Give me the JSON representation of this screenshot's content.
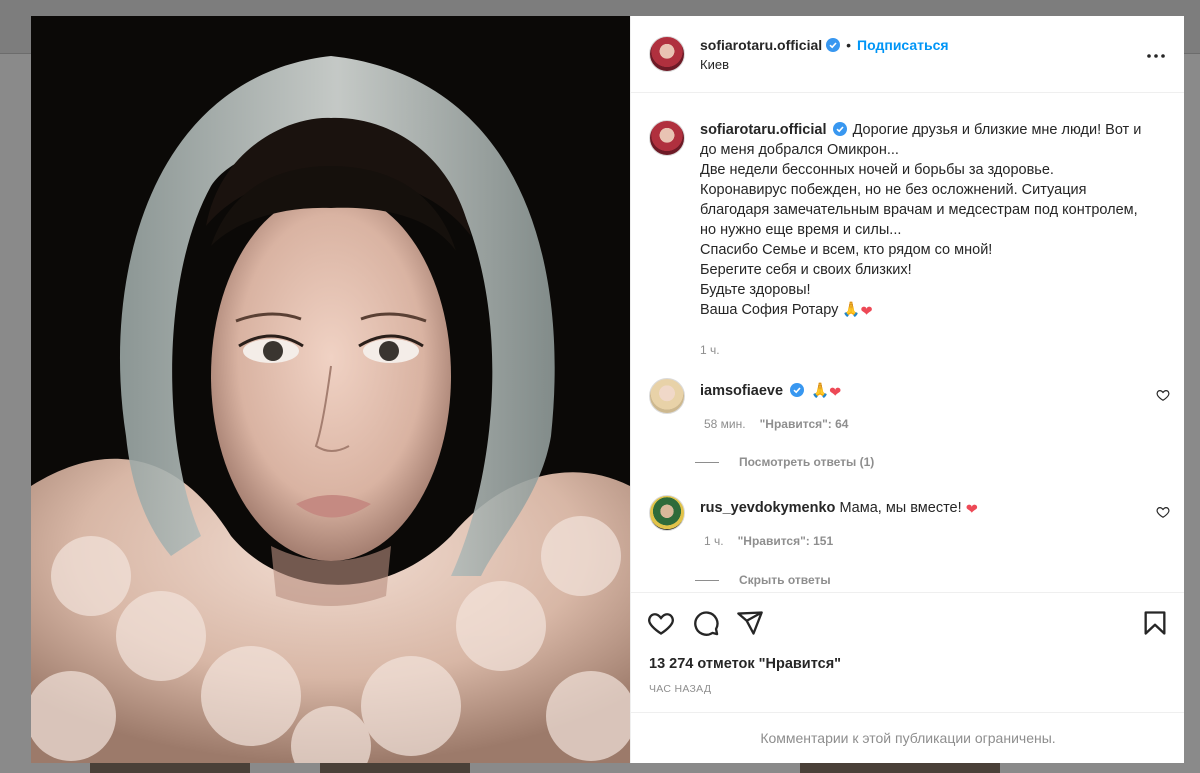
{
  "post": {
    "username": "sofiarotaru.official",
    "follow_label": "Подписаться",
    "separator": "•",
    "location": "Киев",
    "more_icon": "more-horizontal-icon",
    "photo_alt": "portrait",
    "caption": {
      "username": "sofiarotaru.official",
      "lines": [
        "Дорогие друзья и близкие мне люди! Вот и",
        "до меня добрался Омикрон...",
        "Две недели бессонных ночей и борьбы за здоровье.",
        "Коронавирус побежден, но не без осложнений. Ситуация",
        "благодаря замечательным врачам и медсестрам под контролем,",
        "но нужно еще время и силы...",
        "Спасибо Семье и всем, кто рядом со мной!",
        "Берегите себя и своих близких!",
        "Будьте здоровы!",
        "Ваша София Ротару 🙏❤"
      ],
      "time": "1 ч."
    },
    "comments": [
      {
        "username": "iamsofiaeve",
        "text": "🙏❤",
        "time": "58 мин.",
        "likes": "\"Нравится\": 64",
        "replies_label": "Посмотреть ответы (1)"
      },
      {
        "username": "rus_yevdokymenko",
        "text": "Мама, мы вместе! ❤",
        "time": "1 ч.",
        "likes": "\"Нравится\": 151",
        "replies_label": "Скрыть ответы"
      }
    ],
    "likes_count": "13 274 отметок \"Нравится\"",
    "post_time": "ЧАС НАЗАД",
    "comments_restricted": "Комментарии к этой публикации ограничены."
  },
  "colors": {
    "accent": "#0095f6",
    "verified": "#3897f0",
    "heart": "#ed4956",
    "muted": "#8e8e8e",
    "text": "#262626"
  }
}
